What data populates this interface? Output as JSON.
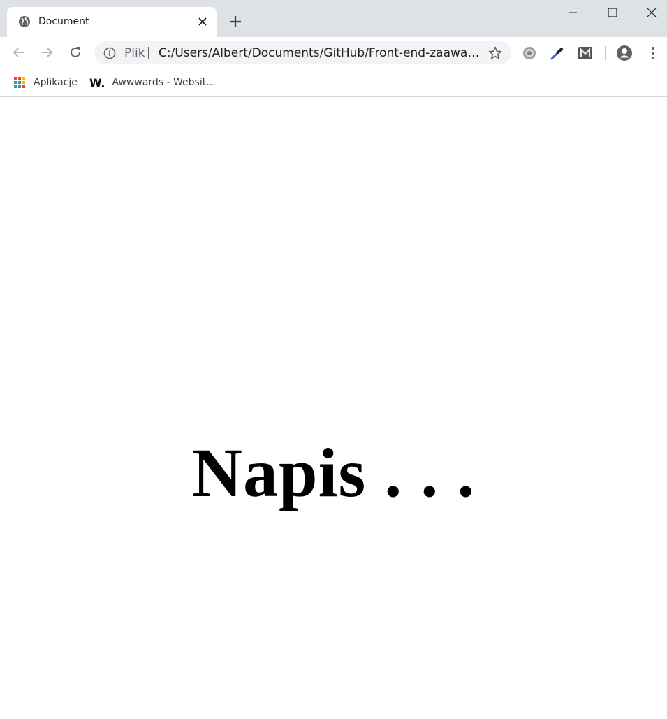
{
  "tab": {
    "title": "Document",
    "favicon": "globe-icon"
  },
  "address_bar": {
    "scheme_label": "Plik",
    "url": "C:/Users/Albert/Documents/GitHub/Front-end-zaawanso..."
  },
  "bookmarks": [
    {
      "label": "Aplikacje",
      "icon": "apps-grid-icon"
    },
    {
      "label": "Awwwards - Websit...",
      "icon": "awwwards-w-icon",
      "icon_text": "W."
    }
  ],
  "page": {
    "heading": "Napis . . ."
  },
  "colors": {
    "tabstrip": "#dee1e6",
    "omnibox": "#f1f3f4",
    "accent": "#1a73e8"
  }
}
